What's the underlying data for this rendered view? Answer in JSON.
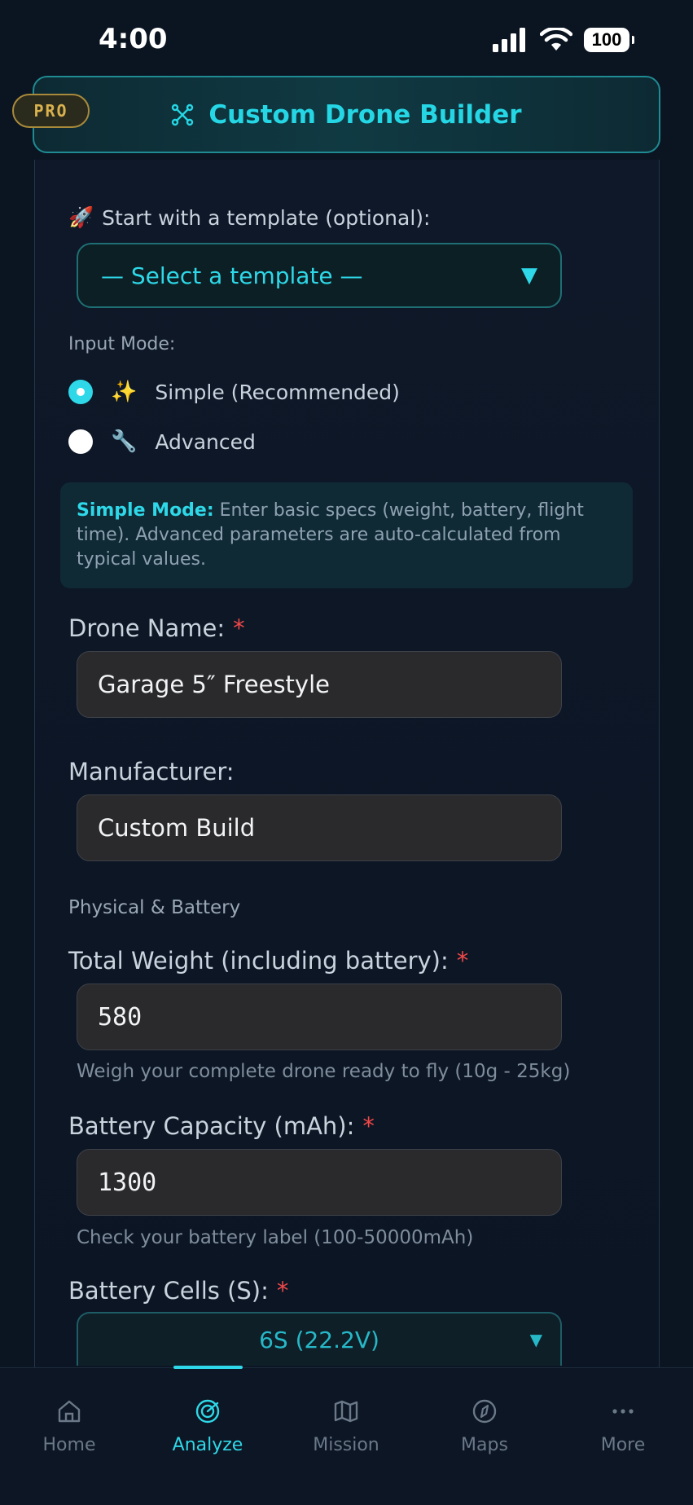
{
  "status": {
    "time": "4:00",
    "battery": "100"
  },
  "header": {
    "title": "Custom Drone Builder",
    "badge": "PRO"
  },
  "template": {
    "emoji": "🚀",
    "label": "Start with a template (optional):",
    "selected": "— Select a template —",
    "arrow": "▼"
  },
  "mode": {
    "label": "Input Mode:",
    "options": [
      {
        "emoji": "✨",
        "label": "Simple (Recommended)",
        "checked": true
      },
      {
        "emoji": "🔧",
        "label": "Advanced",
        "checked": false
      }
    ]
  },
  "info": {
    "bold": "Simple Mode:",
    "text": " Enter basic specs (weight, battery, flight time). Advanced parameters are auto-calculated from typical values."
  },
  "fields": {
    "drone_name": {
      "label": "Drone Name:",
      "value": "Garage 5″ Freestyle",
      "required": "*"
    },
    "manufacturer": {
      "label": "Manufacturer:",
      "value": "Custom Build"
    },
    "section": "Physical & Battery",
    "weight": {
      "label": "Total Weight (including battery):",
      "value": "580",
      "required": "*",
      "hint": "Weigh your complete drone ready to fly (10g - 25kg)"
    },
    "capacity": {
      "label": "Battery Capacity (mAh):",
      "value": "1300",
      "required": "*",
      "hint": "Check your battery label (100-50000mAh)"
    },
    "cells": {
      "label": "Battery Cells (S):",
      "value": "6S (22.2V)",
      "required": "*",
      "arrow": "▼"
    }
  },
  "nav": {
    "items": [
      {
        "label": "Home",
        "icon": "home-icon"
      },
      {
        "label": "Analyze",
        "icon": "analyze-icon"
      },
      {
        "label": "Mission",
        "icon": "map-icon"
      },
      {
        "label": "Maps",
        "icon": "compass-icon"
      },
      {
        "label": "More",
        "icon": "more-icon"
      }
    ],
    "active": "Analyze"
  },
  "colors": {
    "accent": "#2ed8e8",
    "required": "#f04848",
    "pro": "#d9b24e",
    "background": "#0b1421"
  }
}
